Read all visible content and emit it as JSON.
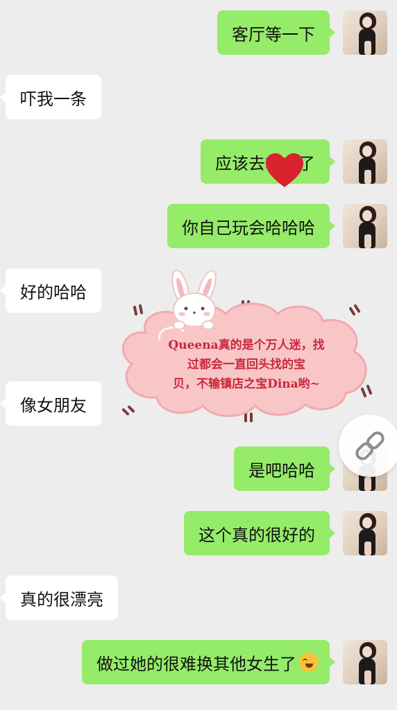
{
  "messages": [
    {
      "side": "right",
      "text": "客厅等一下"
    },
    {
      "side": "left",
      "text": "吓我一条"
    },
    {
      "side": "right",
      "text": "应该去拿衣了"
    },
    {
      "side": "right",
      "text": "你自己玩会哈哈哈"
    },
    {
      "side": "left",
      "text": "好的哈哈"
    },
    {
      "side": "left",
      "text": "像女朋友"
    },
    {
      "side": "right",
      "text": "是吧哈哈"
    },
    {
      "side": "right",
      "text": "这个真的很好的"
    },
    {
      "side": "left",
      "text": "真的很漂亮"
    },
    {
      "side": "right",
      "text": "做过她的很难换其他女生了",
      "emoji": "crying-laughing-emoji"
    }
  ],
  "sticker": {
    "line1": "Queena真的是个万人迷，找",
    "line2": "过都会一直回头找的宝",
    "line3": "贝，不输镇店之宝Dina哟~",
    "cloud_color": "#f9c6c8",
    "text_color": "#c8283a"
  },
  "colors": {
    "background": "#ededed",
    "self_bubble": "#95ec69",
    "other_bubble": "#ffffff",
    "heart": "#d9232e"
  },
  "icons": {
    "heart": "heart-icon",
    "link": "link-icon",
    "emoji": "crying-laughing-emoji"
  }
}
